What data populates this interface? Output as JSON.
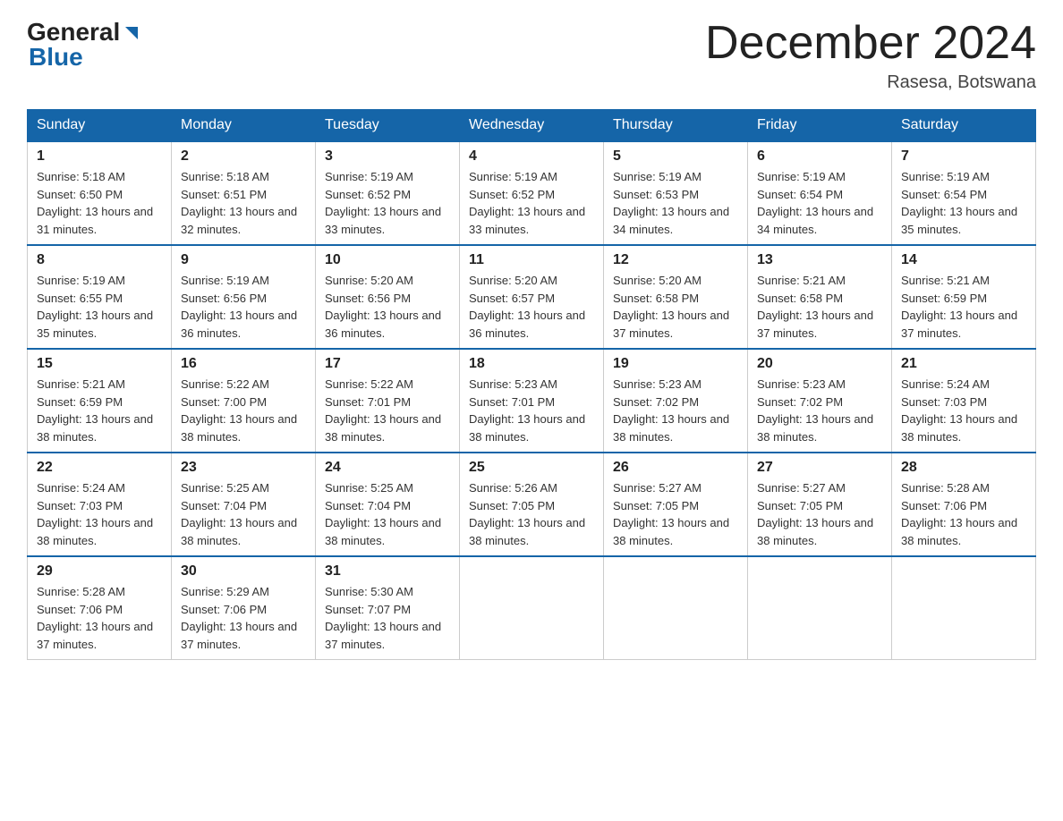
{
  "header": {
    "logo_general": "General",
    "logo_blue": "Blue",
    "month_title": "December 2024",
    "location": "Rasesa, Botswana"
  },
  "days_of_week": [
    "Sunday",
    "Monday",
    "Tuesday",
    "Wednesday",
    "Thursday",
    "Friday",
    "Saturday"
  ],
  "weeks": [
    [
      {
        "num": "1",
        "sunrise": "5:18 AM",
        "sunset": "6:50 PM",
        "daylight": "13 hours and 31 minutes."
      },
      {
        "num": "2",
        "sunrise": "5:18 AM",
        "sunset": "6:51 PM",
        "daylight": "13 hours and 32 minutes."
      },
      {
        "num": "3",
        "sunrise": "5:19 AM",
        "sunset": "6:52 PM",
        "daylight": "13 hours and 33 minutes."
      },
      {
        "num": "4",
        "sunrise": "5:19 AM",
        "sunset": "6:52 PM",
        "daylight": "13 hours and 33 minutes."
      },
      {
        "num": "5",
        "sunrise": "5:19 AM",
        "sunset": "6:53 PM",
        "daylight": "13 hours and 34 minutes."
      },
      {
        "num": "6",
        "sunrise": "5:19 AM",
        "sunset": "6:54 PM",
        "daylight": "13 hours and 34 minutes."
      },
      {
        "num": "7",
        "sunrise": "5:19 AM",
        "sunset": "6:54 PM",
        "daylight": "13 hours and 35 minutes."
      }
    ],
    [
      {
        "num": "8",
        "sunrise": "5:19 AM",
        "sunset": "6:55 PM",
        "daylight": "13 hours and 35 minutes."
      },
      {
        "num": "9",
        "sunrise": "5:19 AM",
        "sunset": "6:56 PM",
        "daylight": "13 hours and 36 minutes."
      },
      {
        "num": "10",
        "sunrise": "5:20 AM",
        "sunset": "6:56 PM",
        "daylight": "13 hours and 36 minutes."
      },
      {
        "num": "11",
        "sunrise": "5:20 AM",
        "sunset": "6:57 PM",
        "daylight": "13 hours and 36 minutes."
      },
      {
        "num": "12",
        "sunrise": "5:20 AM",
        "sunset": "6:58 PM",
        "daylight": "13 hours and 37 minutes."
      },
      {
        "num": "13",
        "sunrise": "5:21 AM",
        "sunset": "6:58 PM",
        "daylight": "13 hours and 37 minutes."
      },
      {
        "num": "14",
        "sunrise": "5:21 AM",
        "sunset": "6:59 PM",
        "daylight": "13 hours and 37 minutes."
      }
    ],
    [
      {
        "num": "15",
        "sunrise": "5:21 AM",
        "sunset": "6:59 PM",
        "daylight": "13 hours and 38 minutes."
      },
      {
        "num": "16",
        "sunrise": "5:22 AM",
        "sunset": "7:00 PM",
        "daylight": "13 hours and 38 minutes."
      },
      {
        "num": "17",
        "sunrise": "5:22 AM",
        "sunset": "7:01 PM",
        "daylight": "13 hours and 38 minutes."
      },
      {
        "num": "18",
        "sunrise": "5:23 AM",
        "sunset": "7:01 PM",
        "daylight": "13 hours and 38 minutes."
      },
      {
        "num": "19",
        "sunrise": "5:23 AM",
        "sunset": "7:02 PM",
        "daylight": "13 hours and 38 minutes."
      },
      {
        "num": "20",
        "sunrise": "5:23 AM",
        "sunset": "7:02 PM",
        "daylight": "13 hours and 38 minutes."
      },
      {
        "num": "21",
        "sunrise": "5:24 AM",
        "sunset": "7:03 PM",
        "daylight": "13 hours and 38 minutes."
      }
    ],
    [
      {
        "num": "22",
        "sunrise": "5:24 AM",
        "sunset": "7:03 PM",
        "daylight": "13 hours and 38 minutes."
      },
      {
        "num": "23",
        "sunrise": "5:25 AM",
        "sunset": "7:04 PM",
        "daylight": "13 hours and 38 minutes."
      },
      {
        "num": "24",
        "sunrise": "5:25 AM",
        "sunset": "7:04 PM",
        "daylight": "13 hours and 38 minutes."
      },
      {
        "num": "25",
        "sunrise": "5:26 AM",
        "sunset": "7:05 PM",
        "daylight": "13 hours and 38 minutes."
      },
      {
        "num": "26",
        "sunrise": "5:27 AM",
        "sunset": "7:05 PM",
        "daylight": "13 hours and 38 minutes."
      },
      {
        "num": "27",
        "sunrise": "5:27 AM",
        "sunset": "7:05 PM",
        "daylight": "13 hours and 38 minutes."
      },
      {
        "num": "28",
        "sunrise": "5:28 AM",
        "sunset": "7:06 PM",
        "daylight": "13 hours and 38 minutes."
      }
    ],
    [
      {
        "num": "29",
        "sunrise": "5:28 AM",
        "sunset": "7:06 PM",
        "daylight": "13 hours and 37 minutes."
      },
      {
        "num": "30",
        "sunrise": "5:29 AM",
        "sunset": "7:06 PM",
        "daylight": "13 hours and 37 minutes."
      },
      {
        "num": "31",
        "sunrise": "5:30 AM",
        "sunset": "7:07 PM",
        "daylight": "13 hours and 37 minutes."
      },
      null,
      null,
      null,
      null
    ]
  ]
}
